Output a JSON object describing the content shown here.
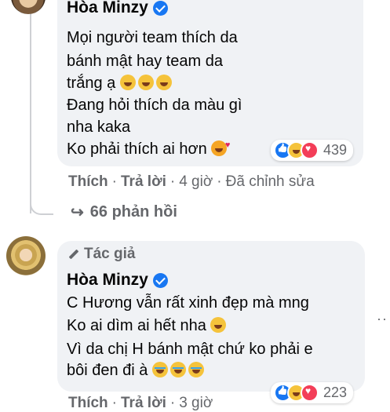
{
  "comment1": {
    "author": "Hòa Minzy",
    "lines": [
      "Mọi người team thích da",
      "bánh mật hay team da",
      "trắng ạ",
      "Đang hỏi thích da màu gì",
      "nha kaka",
      "Ko phải thích ai hơn"
    ],
    "reaction_count": "439",
    "actions": {
      "like": "Thích",
      "reply": "Trả lời",
      "time": "4 giờ",
      "edited": "Đã chỉnh sửa"
    },
    "replies_label": "66 phản hồi"
  },
  "comment2": {
    "badge": "Tác giả",
    "author": "Hòa Minzy",
    "lines": [
      "C Hương vẫn rất xinh đẹp mà mng",
      "Ko ai dìm ai hết nha",
      "Vì da chị H bánh mật chứ ko phải e",
      "bôi đen đi à"
    ],
    "reaction_count": "223",
    "actions": {
      "like": "Thích",
      "reply": "Trả lời",
      "time": "3 giờ"
    }
  },
  "icons": [
    "verified-icon",
    "like-reaction-icon",
    "haha-reaction-icon",
    "love-reaction-icon",
    "reply-arrow-icon",
    "pen-icon",
    "more-options-icon"
  ],
  "colors": {
    "bubble": "#f0f2f5",
    "verified": "#1877f2",
    "secondary_text": "#65676b"
  }
}
